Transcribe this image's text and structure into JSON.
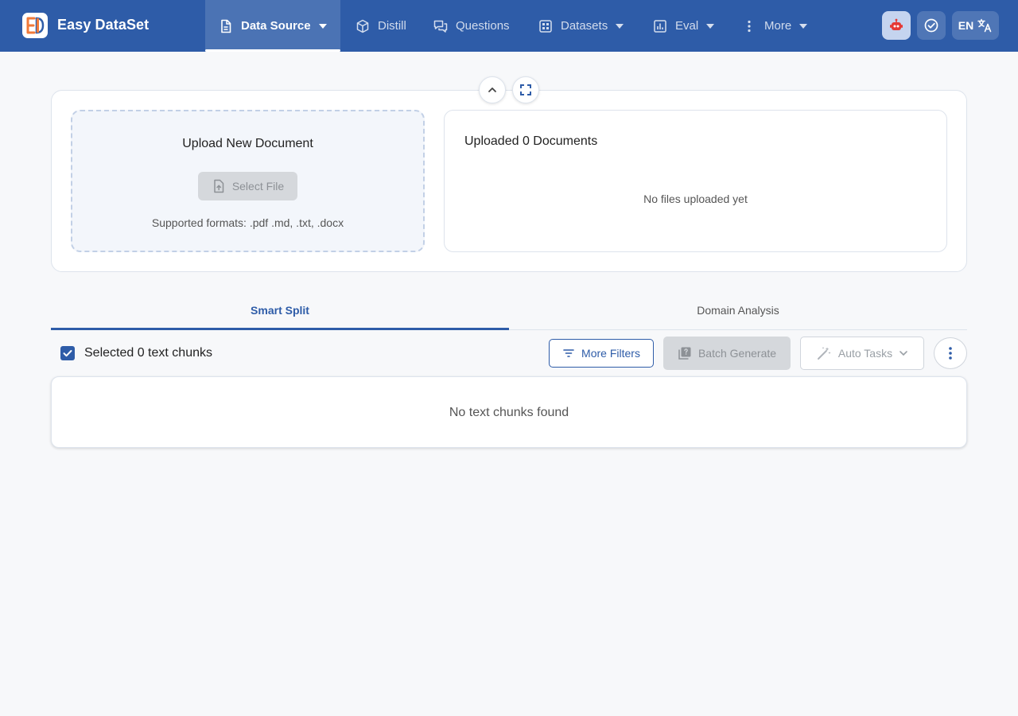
{
  "app": {
    "brand": "Easy DataSet"
  },
  "nav": {
    "items": [
      {
        "label": "Data Source",
        "icon": "document-icon",
        "dropdown": true,
        "active": true
      },
      {
        "label": "Distill",
        "icon": "cube-icon",
        "dropdown": false
      },
      {
        "label": "Questions",
        "icon": "chat-icon",
        "dropdown": false
      },
      {
        "label": "Datasets",
        "icon": "grid-icon",
        "dropdown": true
      },
      {
        "label": "Eval",
        "icon": "bar-chart-icon",
        "dropdown": true
      },
      {
        "label": "More",
        "icon": "kebab-icon",
        "dropdown": true
      }
    ]
  },
  "topbar": {
    "lang_label": "EN"
  },
  "upload": {
    "title": "Upload New Document",
    "select_label": "Select File",
    "formats": "Supported formats: .pdf .md, .txt, .docx"
  },
  "documents": {
    "title": "Uploaded 0 Documents",
    "empty": "No files uploaded yet"
  },
  "tabs": [
    {
      "label": "Smart Split",
      "active": true
    },
    {
      "label": "Domain Analysis",
      "active": false
    }
  ],
  "toolbar": {
    "selected_text": "Selected 0 text chunks",
    "filters_label": "More Filters",
    "batch_label": "Batch Generate",
    "auto_label": "Auto Tasks"
  },
  "chunks": {
    "empty": "No text chunks found"
  },
  "colors": {
    "primary": "#2e5ca8",
    "background": "#f7f8fa",
    "disabled": "#d5d8dc",
    "logo_accent": "#f07a3a",
    "robot_red": "#e53935"
  }
}
